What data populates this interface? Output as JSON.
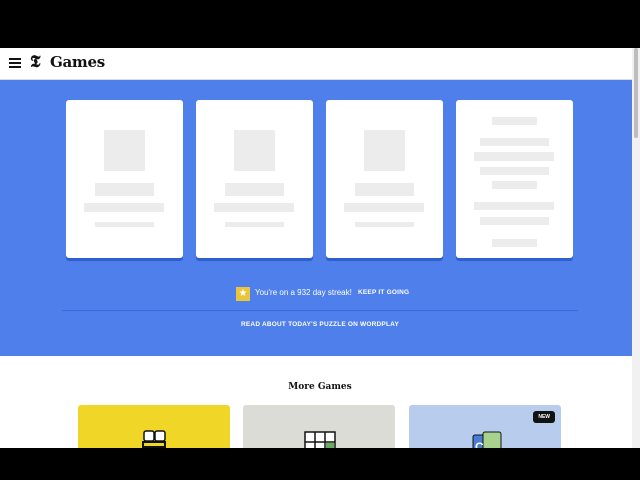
{
  "header": {
    "logo_mark": "𝕿",
    "title": "Games"
  },
  "hero": {
    "streak_star": "★",
    "streak_text": "You're on a 932 day streak!",
    "streak_cta": "KEEP IT GOING",
    "wordplay_link": "READ ABOUT TODAY'S PUZZLE ON WORDPLAY",
    "colors": {
      "background": "#4f7fea",
      "star": "#e8c53a"
    }
  },
  "more_games": {
    "title": "More Games",
    "tiles": [
      {
        "icon": "bee-icon",
        "color": "#f0d727"
      },
      {
        "icon": "grid-icon",
        "color": "#dcdcd7"
      },
      {
        "icon": "connections-icon",
        "color": "#b8cdee",
        "badge": "NEW"
      }
    ]
  }
}
